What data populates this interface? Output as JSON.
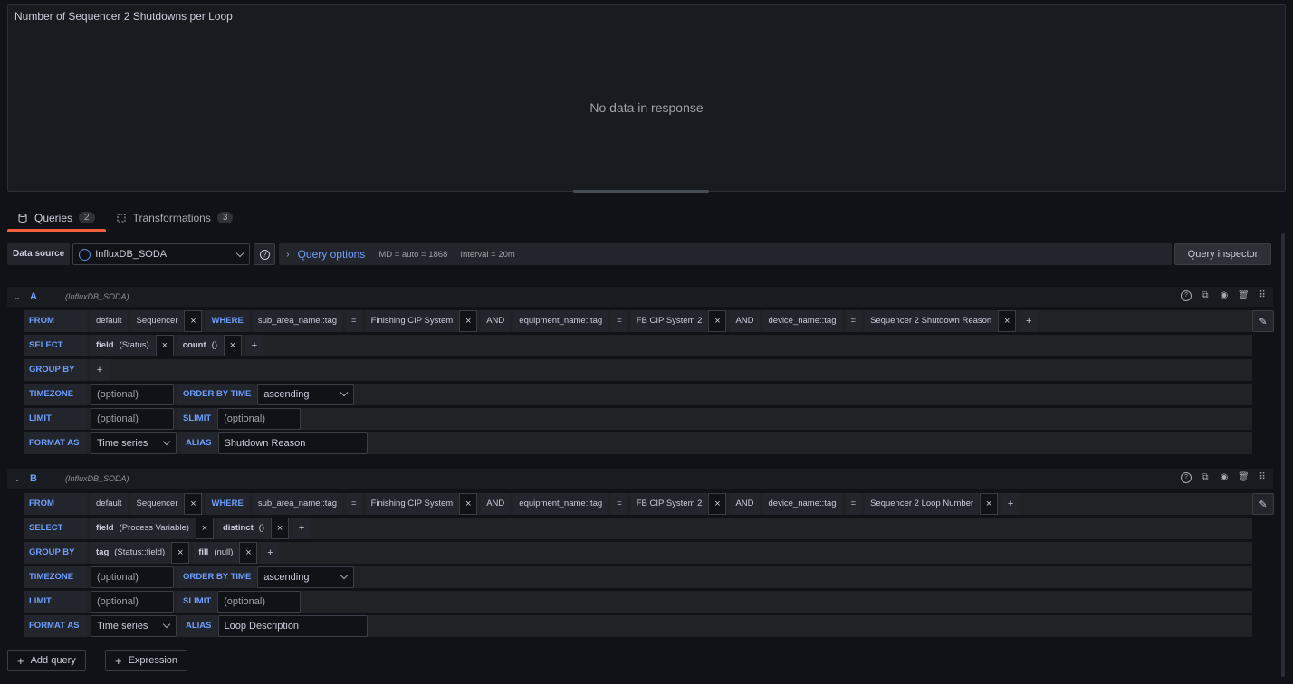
{
  "panel": {
    "title": "Number of Sequencer 2 Shutdowns per Loop",
    "empty_message": "No data in response"
  },
  "tabs": [
    {
      "label": "Queries",
      "count": "2",
      "icon": "database-icon"
    },
    {
      "label": "Transformations",
      "count": "3",
      "icon": "transform-icon"
    }
  ],
  "datasource": {
    "label": "Data source",
    "value": "InfluxDB_SODA",
    "query_options_label": "Query options",
    "md": "MD = auto = 1868",
    "interval": "Interval = 20m",
    "inspector_label": "Query inspector"
  },
  "queries": [
    {
      "ref": "A",
      "ds": "(InfluxDB_SODA)",
      "from": {
        "label": "FROM",
        "policy": "default",
        "measurement": "Sequencer",
        "where_label": "WHERE",
        "conds": [
          {
            "key": "sub_area_name::tag",
            "op": "=",
            "value": "Finishing CIP System"
          },
          {
            "and": "AND",
            "key": "equipment_name::tag",
            "op": "=",
            "value": "FB CIP System 2"
          },
          {
            "and": "AND",
            "key": "device_name::tag",
            "op": "=",
            "value": "Sequencer 2 Shutdown Reason"
          }
        ]
      },
      "select": {
        "label": "SELECT",
        "field": "field",
        "field_arg": "(Status)",
        "fn": "count",
        "fn_arg": "()"
      },
      "group_by": {
        "label": "GROUP BY"
      },
      "timezone": {
        "label": "TIMEZONE",
        "placeholder": "(optional)",
        "order_label": "ORDER BY TIME",
        "order_value": "ascending"
      },
      "limit": {
        "label": "LIMIT",
        "placeholder": "(optional)",
        "slimit_label": "SLIMIT",
        "slimit_placeholder": "(optional)"
      },
      "format": {
        "label": "FORMAT AS",
        "value": "Time series",
        "alias_label": "ALIAS",
        "alias_value": "Shutdown Reason"
      }
    },
    {
      "ref": "B",
      "ds": "(InfluxDB_SODA)",
      "from": {
        "label": "FROM",
        "policy": "default",
        "measurement": "Sequencer",
        "where_label": "WHERE",
        "conds": [
          {
            "key": "sub_area_name::tag",
            "op": "=",
            "value": "Finishing CIP System"
          },
          {
            "and": "AND",
            "key": "equipment_name::tag",
            "op": "=",
            "value": "FB CIP System 2"
          },
          {
            "and": "AND",
            "key": "device_name::tag",
            "op": "=",
            "value": "Sequencer 2 Loop Number"
          }
        ]
      },
      "select": {
        "label": "SELECT",
        "field": "field",
        "field_arg": "(Process Variable)",
        "fn": "distinct",
        "fn_arg": "()"
      },
      "group_by": {
        "label": "GROUP BY",
        "tag": "tag",
        "tag_arg": "(Status::field)",
        "fill": "fill",
        "fill_arg": "(null)"
      },
      "timezone": {
        "label": "TIMEZONE",
        "placeholder": "(optional)",
        "order_label": "ORDER BY TIME",
        "order_value": "ascending"
      },
      "limit": {
        "label": "LIMIT",
        "placeholder": "(optional)",
        "slimit_label": "SLIMIT",
        "slimit_placeholder": "(optional)"
      },
      "format": {
        "label": "FORMAT AS",
        "value": "Time series",
        "alias_label": "ALIAS",
        "alias_value": "Loop Description"
      }
    }
  ],
  "buttons": {
    "add_query": "Add query",
    "expression": "Expression"
  },
  "colors": {
    "accent": "#6e9fff",
    "active_tab": "#f55f3e",
    "background": "#111217"
  }
}
